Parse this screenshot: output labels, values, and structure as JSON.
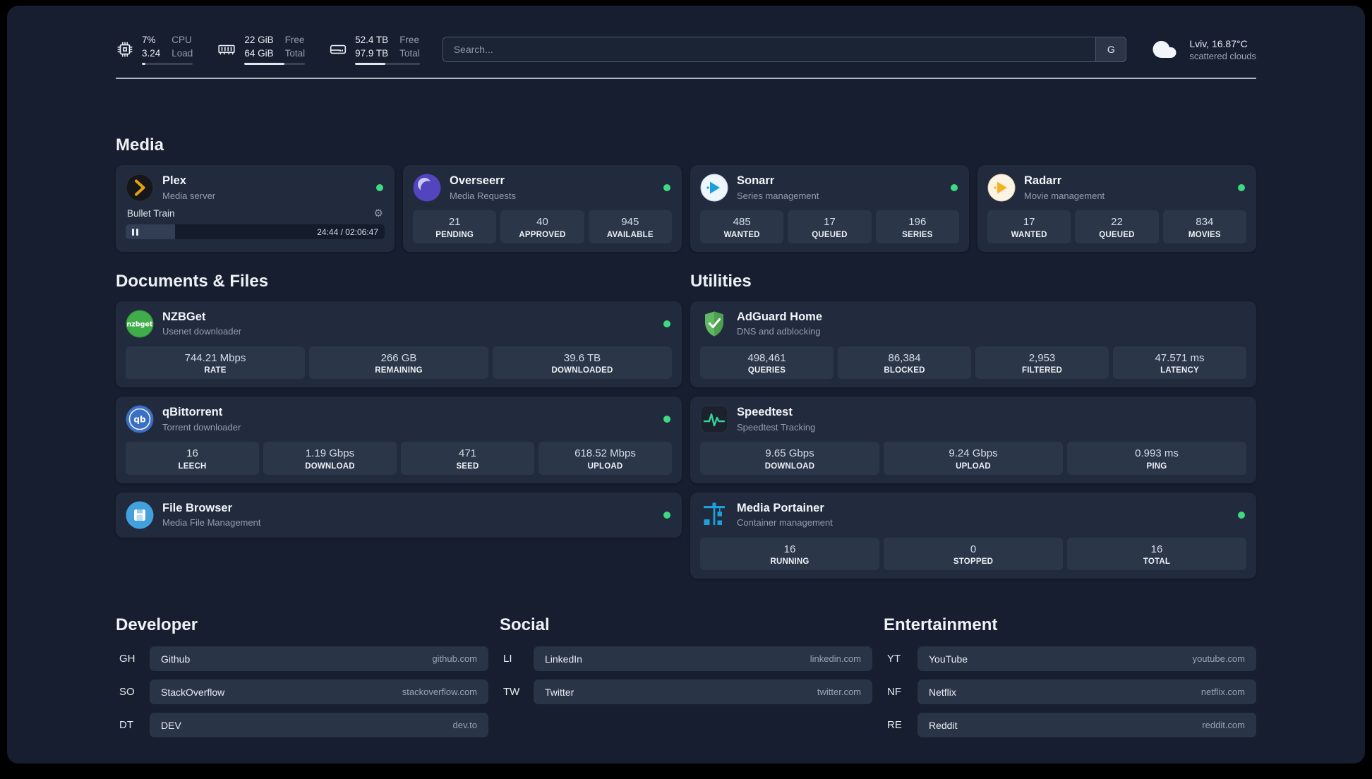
{
  "topbar": {
    "cpu": {
      "percent": "7%",
      "load": "3.24",
      "label_top": "CPU",
      "label_bottom": "Load",
      "bar_percent": 7
    },
    "memory": {
      "free": "22 GiB",
      "total": "64 GiB",
      "label_top": "Free",
      "label_bottom": "Total",
      "bar_percent": 66
    },
    "disk": {
      "free": "52.4 TB",
      "total": "97.9 TB",
      "label_top": "Free",
      "label_bottom": "Total",
      "bar_percent": 47
    },
    "search": {
      "placeholder": "Search...",
      "provider_button": "G"
    },
    "weather": {
      "location": "Lviv, 16.87°C",
      "condition": "scattered clouds"
    }
  },
  "media": {
    "title": "Media",
    "plex": {
      "name": "Plex",
      "desc": "Media server",
      "status": "online",
      "player_track": "Bullet Train",
      "player_time": "24:44 / 02:06:47",
      "player_progress_percent": 19
    },
    "overseerr": {
      "name": "Overseerr",
      "desc": "Media Requests",
      "status": "online",
      "stats": [
        {
          "value": "21",
          "label": "PENDING"
        },
        {
          "value": "40",
          "label": "APPROVED"
        },
        {
          "value": "945",
          "label": "AVAILABLE"
        }
      ]
    },
    "sonarr": {
      "name": "Sonarr",
      "desc": "Series management",
      "status": "online",
      "stats": [
        {
          "value": "485",
          "label": "WANTED"
        },
        {
          "value": "17",
          "label": "QUEUED"
        },
        {
          "value": "196",
          "label": "SERIES"
        }
      ]
    },
    "radarr": {
      "name": "Radarr",
      "desc": "Movie management",
      "status": "online",
      "stats": [
        {
          "value": "17",
          "label": "WANTED"
        },
        {
          "value": "22",
          "label": "QUEUED"
        },
        {
          "value": "834",
          "label": "MOVIES"
        }
      ]
    }
  },
  "documents": {
    "title": "Documents & Files",
    "nzbget": {
      "name": "NZBGet",
      "desc": "Usenet downloader",
      "status": "online",
      "stats": [
        {
          "value": "744.21 Mbps",
          "label": "RATE"
        },
        {
          "value": "266 GB",
          "label": "REMAINING"
        },
        {
          "value": "39.6 TB",
          "label": "DOWNLOADED"
        }
      ]
    },
    "qbittorrent": {
      "name": "qBittorrent",
      "desc": "Torrent downloader",
      "status": "online",
      "stats": [
        {
          "value": "16",
          "label": "LEECH"
        },
        {
          "value": "1.19 Gbps",
          "label": "DOWNLOAD"
        },
        {
          "value": "471",
          "label": "SEED"
        },
        {
          "value": "618.52 Mbps",
          "label": "UPLOAD"
        }
      ]
    },
    "filebrowser": {
      "name": "File Browser",
      "desc": "Media File Management",
      "status": "online"
    }
  },
  "utilities": {
    "title": "Utilities",
    "adguard": {
      "name": "AdGuard Home",
      "desc": "DNS and adblocking",
      "stats": [
        {
          "value": "498,461",
          "label": "QUERIES"
        },
        {
          "value": "86,384",
          "label": "BLOCKED"
        },
        {
          "value": "2,953",
          "label": "FILTERED"
        },
        {
          "value": "47.571 ms",
          "label": "LATENCY"
        }
      ]
    },
    "speedtest": {
      "name": "Speedtest",
      "desc": "Speedtest Tracking",
      "stats": [
        {
          "value": "9.65 Gbps",
          "label": "DOWNLOAD"
        },
        {
          "value": "9.24 Gbps",
          "label": "UPLOAD"
        },
        {
          "value": "0.993 ms",
          "label": "PING"
        }
      ]
    },
    "portainer": {
      "name": "Media Portainer",
      "desc": "Container management",
      "status": "online",
      "stats": [
        {
          "value": "16",
          "label": "RUNNING"
        },
        {
          "value": "0",
          "label": "STOPPED"
        },
        {
          "value": "16",
          "label": "TOTAL"
        }
      ]
    }
  },
  "bookmarks": {
    "developer": {
      "title": "Developer",
      "items": [
        {
          "abbr": "GH",
          "name": "Github",
          "url": "github.com"
        },
        {
          "abbr": "SO",
          "name": "StackOverflow",
          "url": "stackoverflow.com"
        },
        {
          "abbr": "DT",
          "name": "DEV",
          "url": "dev.to"
        }
      ]
    },
    "social": {
      "title": "Social",
      "items": [
        {
          "abbr": "LI",
          "name": "LinkedIn",
          "url": "linkedin.com"
        },
        {
          "abbr": "TW",
          "name": "Twitter",
          "url": "twitter.com"
        }
      ]
    },
    "entertainment": {
      "title": "Entertainment",
      "items": [
        {
          "abbr": "YT",
          "name": "YouTube",
          "url": "youtube.com"
        },
        {
          "abbr": "NF",
          "name": "Netflix",
          "url": "netflix.com"
        },
        {
          "abbr": "RE",
          "name": "Reddit",
          "url": "reddit.com"
        }
      ]
    }
  }
}
